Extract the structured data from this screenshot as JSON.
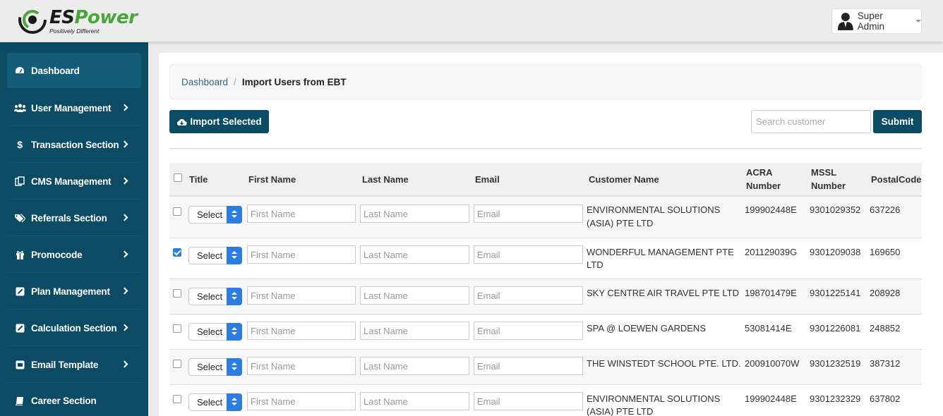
{
  "header": {
    "logo_main": "ES",
    "logo_accent": "Power",
    "logo_tagline": "Positively Different",
    "user_name": "Super Admin"
  },
  "sidebar": {
    "items": [
      {
        "label": "Dashboard",
        "icon": "dashboard-icon",
        "active": true,
        "chevron": false
      },
      {
        "label": "User Management",
        "icon": "users-icon",
        "chevron": true
      },
      {
        "label": "Transaction Section",
        "icon": "dollar-icon",
        "chevron": true
      },
      {
        "label": "CMS Management",
        "icon": "copy-icon",
        "chevron": true
      },
      {
        "label": "Referrals Section",
        "icon": "tags-icon",
        "chevron": true
      },
      {
        "label": "Promocode",
        "icon": "gift-icon",
        "chevron": true
      },
      {
        "label": "Plan Management",
        "icon": "edit-icon",
        "chevron": true
      },
      {
        "label": "Calculation Section",
        "icon": "edit-icon",
        "chevron": true
      },
      {
        "label": "Email Template",
        "icon": "envelope-icon",
        "chevron": true
      },
      {
        "label": "Career Section",
        "icon": "book-icon",
        "chevron": false
      }
    ]
  },
  "breadcrumb": {
    "home": "Dashboard",
    "separator": "/",
    "current": "Import Users from EBT"
  },
  "toolbar": {
    "import_label": "Import Selected",
    "search_placeholder": "Search customer",
    "submit_label": "Submit"
  },
  "table": {
    "headers": {
      "title": "Title",
      "first_name": "First Name",
      "last_name": "Last Name",
      "email": "Email",
      "customer_name": "Customer Name",
      "acra_1": "ACRA",
      "acra_2": "Number",
      "mssl_1": "MSSL",
      "mssl_2": "Number",
      "postal": "PostalCode"
    },
    "select_label": "Select",
    "first_name_placeholder": "First Name",
    "last_name_placeholder": "Last Name",
    "email_placeholder": "Email",
    "rows": [
      {
        "checked": false,
        "customer_1": "ENVIRONMENTAL SOLUTIONS",
        "customer_2": "(ASIA) PTE LTD",
        "acra": "199902448E",
        "mssl": "9301029352",
        "postal": "637226"
      },
      {
        "checked": true,
        "customer_1": "WONDERFUL MANAGEMENT PTE",
        "customer_2": "LTD",
        "acra": "201129039G",
        "mssl": "9301209038",
        "postal": "169650"
      },
      {
        "checked": false,
        "customer_1": "SKY CENTRE AIR TRAVEL PTE LTD",
        "customer_2": "",
        "acra": "198701479E",
        "mssl": "9301225141",
        "postal": "208928"
      },
      {
        "checked": false,
        "customer_1": "SPA @ LOEWEN GARDENS",
        "customer_2": "",
        "acra": "53081414E",
        "mssl": "9301226081",
        "postal": "248852"
      },
      {
        "checked": false,
        "customer_1": "THE WINSTEDT SCHOOL PTE. LTD.",
        "customer_2": "",
        "acra": "200910070W",
        "mssl": "9301232519",
        "postal": "387312"
      },
      {
        "checked": false,
        "customer_1": "ENVIRONMENTAL SOLUTIONS",
        "customer_2": "(ASIA) PTE LTD",
        "acra": "199902448E",
        "mssl": "9301232329",
        "postal": "637802"
      }
    ]
  },
  "colors": {
    "sidebar_bg": "#0b4b63",
    "primary_button": "#0b4b63",
    "select_accent": "#2b7de1",
    "logo_green": "#4aa63a"
  }
}
